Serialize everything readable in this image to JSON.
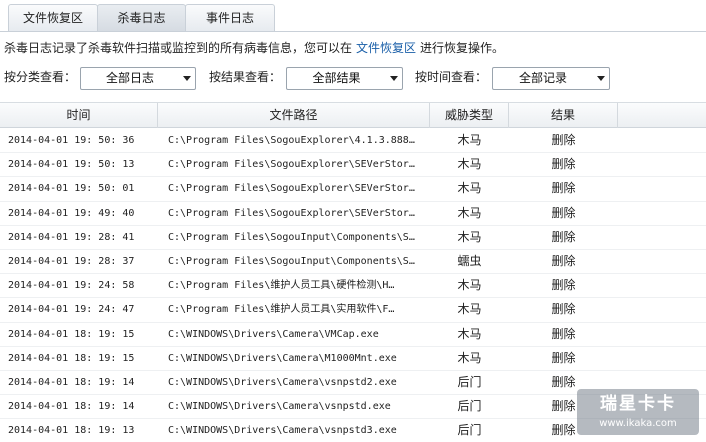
{
  "tabs": [
    {
      "label": "文件恢复区",
      "active": false
    },
    {
      "label": "杀毒日志",
      "active": true
    },
    {
      "label": "事件日志",
      "active": false
    }
  ],
  "description": {
    "text_before": "杀毒日志记录了杀毒软件扫描或监控到的所有病毒信息，您可以在",
    "link": "文件恢复区",
    "text_after": "进行恢复操作。"
  },
  "filters": [
    {
      "label": "按分类查看：",
      "value": "全部日志"
    },
    {
      "label": "按结果查看：",
      "value": "全部结果"
    },
    {
      "label": "按时间查看：",
      "value": "全部记录"
    }
  ],
  "table": {
    "headers": [
      "时间",
      "文件路径",
      "威胁类型",
      "结果"
    ],
    "rows": [
      {
        "time": "2014-04-01 19: 50: 36",
        "path": "C:\\Program  Files\\SogouExplorer\\4.1.3.888…",
        "type": "木马",
        "result": "删除"
      },
      {
        "time": "2014-04-01 19: 50: 13",
        "path": "C:\\Program  Files\\SogouExplorer\\SEVerStor…",
        "type": "木马",
        "result": "删除"
      },
      {
        "time": "2014-04-01 19: 50: 01",
        "path": "C:\\Program  Files\\SogouExplorer\\SEVerStor…",
        "type": "木马",
        "result": "删除"
      },
      {
        "time": "2014-04-01 19: 49: 40",
        "path": "C:\\Program  Files\\SogouExplorer\\SEVerStor…",
        "type": "木马",
        "result": "删除"
      },
      {
        "time": "2014-04-01 19: 28: 41",
        "path": "C:\\Program  Files\\SogouInput\\Components\\S…",
        "type": "木马",
        "result": "删除"
      },
      {
        "time": "2014-04-01 19: 28: 37",
        "path": "C:\\Program  Files\\SogouInput\\Components\\S…",
        "type": "蠕虫",
        "result": "删除"
      },
      {
        "time": "2014-04-01 19: 24: 58",
        "path": "C:\\Program  Files\\维护人员工具\\硬件检测\\H…",
        "type": "木马",
        "result": "删除"
      },
      {
        "time": "2014-04-01 19: 24: 47",
        "path": "C:\\Program  Files\\维护人员工具\\实用软件\\F…",
        "type": "木马",
        "result": "删除"
      },
      {
        "time": "2014-04-01 18: 19: 15",
        "path": "C:\\WINDOWS\\Drivers\\Camera\\VMCap.exe",
        "type": "木马",
        "result": "删除"
      },
      {
        "time": "2014-04-01 18: 19: 15",
        "path": "C:\\WINDOWS\\Drivers\\Camera\\M1000Mnt.exe",
        "type": "木马",
        "result": "删除"
      },
      {
        "time": "2014-04-01 18: 19: 14",
        "path": "C:\\WINDOWS\\Drivers\\Camera\\vsnpstd2.exe",
        "type": "后门",
        "result": "删除"
      },
      {
        "time": "2014-04-01 18: 19: 14",
        "path": "C:\\WINDOWS\\Drivers\\Camera\\vsnpstd.exe",
        "type": "后门",
        "result": "删除"
      },
      {
        "time": "2014-04-01 18: 19: 13",
        "path": "C:\\WINDOWS\\Drivers\\Camera\\vsnpstd3.exe",
        "type": "后门",
        "result": "删除"
      }
    ]
  },
  "watermark": {
    "brand": "瑞星卡卡",
    "url": "www.ikaka.com"
  },
  "colors": {
    "link": "#1a5fa8",
    "header_bg": "#eceff2",
    "border": "#c9d0d8"
  }
}
